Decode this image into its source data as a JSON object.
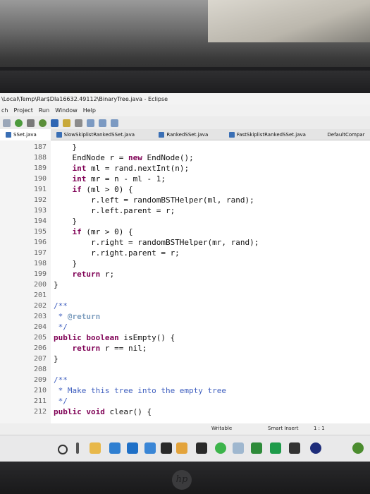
{
  "window": {
    "title": "\\Local\\Temp\\Rar$DIa16632.49112\\BinaryTree.java - Eclipse"
  },
  "menu": [
    "ch",
    "Project",
    "Run",
    "Window",
    "Help"
  ],
  "tabs": [
    {
      "label": "SSet.java",
      "active": true
    },
    {
      "label": "SlowSkiplistRankedSSet.java",
      "active": false
    },
    {
      "label": "RankedSSet.java",
      "active": false
    },
    {
      "label": "FastSkiplistRankedSSet.java",
      "active": false
    },
    {
      "label": "DefaultCompar",
      "active": false
    }
  ],
  "editor": {
    "lines": [
      {
        "num": "187",
        "segments": [
          {
            "t": "    }",
            "c": ""
          }
        ]
      },
      {
        "num": "188",
        "segments": [
          {
            "t": "    EndNode r = ",
            "c": ""
          },
          {
            "t": "new",
            "c": "kw"
          },
          {
            "t": " EndNode();",
            "c": ""
          }
        ]
      },
      {
        "num": "189",
        "segments": [
          {
            "t": "    ",
            "c": ""
          },
          {
            "t": "int",
            "c": "kw"
          },
          {
            "t": " ml = rand.nextInt(n);",
            "c": ""
          }
        ]
      },
      {
        "num": "190",
        "segments": [
          {
            "t": "    ",
            "c": ""
          },
          {
            "t": "int",
            "c": "kw"
          },
          {
            "t": " mr = n - ml - 1;",
            "c": ""
          }
        ]
      },
      {
        "num": "191",
        "segments": [
          {
            "t": "    ",
            "c": ""
          },
          {
            "t": "if",
            "c": "kw"
          },
          {
            "t": " (ml > 0) {",
            "c": ""
          }
        ]
      },
      {
        "num": "192",
        "segments": [
          {
            "t": "        r.left = randomBSTHelper(ml, rand);",
            "c": ""
          }
        ]
      },
      {
        "num": "193",
        "segments": [
          {
            "t": "        r.left.parent = r;",
            "c": ""
          }
        ]
      },
      {
        "num": "194",
        "segments": [
          {
            "t": "    }",
            "c": ""
          }
        ]
      },
      {
        "num": "195",
        "segments": [
          {
            "t": "    ",
            "c": ""
          },
          {
            "t": "if",
            "c": "kw"
          },
          {
            "t": " (mr > 0) {",
            "c": ""
          }
        ]
      },
      {
        "num": "196",
        "segments": [
          {
            "t": "        r.right = randomBSTHelper(mr, rand);",
            "c": ""
          }
        ]
      },
      {
        "num": "197",
        "segments": [
          {
            "t": "        r.right.parent = r;",
            "c": ""
          }
        ]
      },
      {
        "num": "198",
        "segments": [
          {
            "t": "    }",
            "c": ""
          }
        ]
      },
      {
        "num": "199",
        "segments": [
          {
            "t": "    ",
            "c": ""
          },
          {
            "t": "return",
            "c": "kw"
          },
          {
            "t": " r;",
            "c": ""
          }
        ]
      },
      {
        "num": "200",
        "segments": [
          {
            "t": "}",
            "c": ""
          }
        ]
      },
      {
        "num": "201",
        "segments": []
      },
      {
        "num": "202",
        "segments": [
          {
            "t": "/**",
            "c": "doc"
          }
        ]
      },
      {
        "num": "203",
        "segments": [
          {
            "t": " * ",
            "c": "doc"
          },
          {
            "t": "@return",
            "c": "tag"
          }
        ]
      },
      {
        "num": "204",
        "segments": [
          {
            "t": " */",
            "c": "doc"
          }
        ]
      },
      {
        "num": "205",
        "segments": [
          {
            "t": "public",
            "c": "kw"
          },
          {
            "t": " ",
            "c": ""
          },
          {
            "t": "boolean",
            "c": "kw"
          },
          {
            "t": " isEmpty() {",
            "c": ""
          }
        ]
      },
      {
        "num": "206",
        "segments": [
          {
            "t": "    ",
            "c": ""
          },
          {
            "t": "return",
            "c": "kw"
          },
          {
            "t": " r == nil;",
            "c": ""
          }
        ]
      },
      {
        "num": "207",
        "segments": [
          {
            "t": "}",
            "c": ""
          }
        ]
      },
      {
        "num": "208",
        "segments": []
      },
      {
        "num": "209",
        "segments": [
          {
            "t": "/**",
            "c": "doc"
          }
        ]
      },
      {
        "num": "210",
        "segments": [
          {
            "t": " * Make this tree into the empty tree",
            "c": "doc"
          }
        ]
      },
      {
        "num": "211",
        "segments": [
          {
            "t": " */",
            "c": "doc"
          }
        ]
      },
      {
        "num": "212",
        "segments": [
          {
            "t": "public",
            "c": "kw"
          },
          {
            "t": " ",
            "c": ""
          },
          {
            "t": "void",
            "c": "kw"
          },
          {
            "t": " clear() {",
            "c": ""
          }
        ]
      }
    ]
  },
  "status": {
    "writable": "Writable",
    "insert_mode": "Smart Insert",
    "position": "1 : 1"
  },
  "monitor_logo": "hp"
}
